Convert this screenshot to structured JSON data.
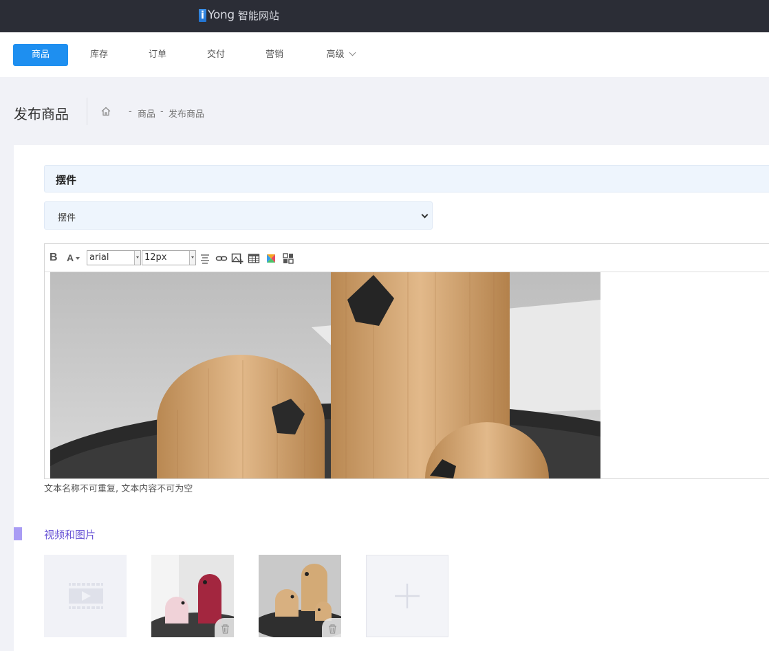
{
  "app": {
    "logo_letter": "i",
    "logo_rest": "Yong",
    "logo_cn": "智能网站"
  },
  "nav": {
    "items": [
      {
        "label": "商品",
        "active": true
      },
      {
        "label": "库存"
      },
      {
        "label": "订单"
      },
      {
        "label": "交付"
      },
      {
        "label": "营销"
      },
      {
        "label": "高级",
        "has_dropdown": true
      }
    ]
  },
  "page": {
    "title": "发布商品",
    "breadcrumb": [
      "商品",
      "发布商品"
    ],
    "breadcrumb_sep": "-"
  },
  "section": {
    "title": "摆件",
    "select_value": "摆件"
  },
  "editor": {
    "toolbar": {
      "bold": "B",
      "font_color": "A",
      "font_family": "arial",
      "font_size": "12px",
      "icons": [
        "align-icon",
        "link-icon",
        "insert-image-icon",
        "table-icon",
        "color-palette-icon",
        "grid-icon"
      ]
    },
    "hint": "文本名称不可重复, 文本内容不可为空"
  },
  "media": {
    "title": "视频和图片",
    "items": [
      {
        "type": "video-placeholder"
      },
      {
        "type": "image",
        "name": "pink and red wooden birds"
      },
      {
        "type": "image",
        "name": "three wooden birds on tray"
      },
      {
        "type": "add"
      }
    ]
  },
  "colors": {
    "topbar": "#2b2d36",
    "accent": "#1e8ff0",
    "section_bg": "#eef5fd",
    "media_title": "#6a56d6",
    "marker": "#a99cf4"
  }
}
